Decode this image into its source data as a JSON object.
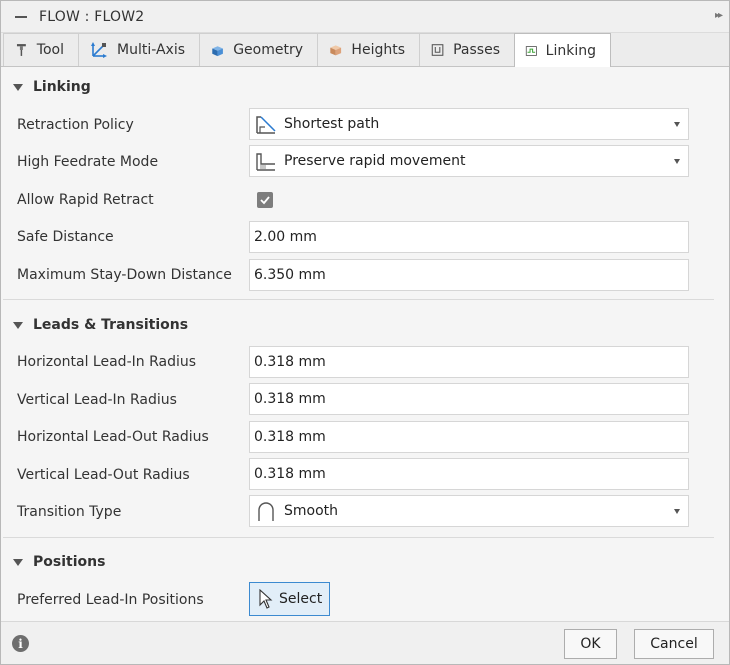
{
  "window": {
    "title": "FLOW : FLOW2",
    "expand_glyph": "▸▸"
  },
  "tabs": [
    {
      "label": "Tool",
      "icon": "tool-icon"
    },
    {
      "label": "Multi-Axis",
      "icon": "multi-axis-icon"
    },
    {
      "label": "Geometry",
      "icon": "geometry-icon"
    },
    {
      "label": "Heights",
      "icon": "heights-icon"
    },
    {
      "label": "Passes",
      "icon": "passes-icon"
    },
    {
      "label": "Linking",
      "icon": "linking-icon",
      "active": true
    }
  ],
  "linking": {
    "header": "Linking",
    "retraction_policy": {
      "label": "Retraction Policy",
      "value": "Shortest path",
      "icon": "shortest-path-icon"
    },
    "high_feedrate_mode": {
      "label": "High Feedrate Mode",
      "value": "Preserve rapid movement",
      "icon": "rapid-movement-icon"
    },
    "allow_rapid_retract": {
      "label": "Allow Rapid Retract",
      "checked": true
    },
    "safe_distance": {
      "label": "Safe Distance",
      "value": "2.00 mm"
    },
    "max_stay_down": {
      "label": "Maximum Stay-Down Distance",
      "value": "6.350 mm"
    }
  },
  "leads": {
    "header": "Leads & Transitions",
    "h_lead_in": {
      "label": "Horizontal Lead-In Radius",
      "value": "0.318 mm"
    },
    "v_lead_in": {
      "label": "Vertical Lead-In Radius",
      "value": "0.318 mm"
    },
    "h_lead_out": {
      "label": "Horizontal Lead-Out Radius",
      "value": "0.318 mm"
    },
    "v_lead_out": {
      "label": "Vertical Lead-Out Radius",
      "value": "0.318 mm"
    },
    "transition_type": {
      "label": "Transition Type",
      "value": "Smooth",
      "icon": "smooth-transition-icon"
    }
  },
  "positions": {
    "header": "Positions",
    "preferred_lead_in": {
      "label": "Preferred Lead-In Positions",
      "button": "Select"
    }
  },
  "footer": {
    "ok": "OK",
    "cancel": "Cancel",
    "info_glyph": "i"
  },
  "colors": {
    "accent": "#3c8ad0",
    "checkbox": "#7d7d7d",
    "select_button_bg": "#e2eef8"
  }
}
